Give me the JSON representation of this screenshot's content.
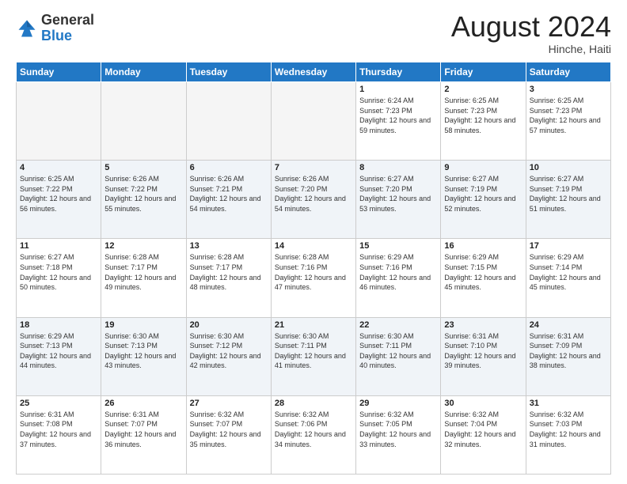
{
  "logo": {
    "general": "General",
    "blue": "Blue"
  },
  "header": {
    "month": "August 2024",
    "location": "Hinche, Haiti"
  },
  "weekdays": [
    "Sunday",
    "Monday",
    "Tuesday",
    "Wednesday",
    "Thursday",
    "Friday",
    "Saturday"
  ],
  "weeks": [
    [
      {
        "day": "",
        "empty": true
      },
      {
        "day": "",
        "empty": true
      },
      {
        "day": "",
        "empty": true
      },
      {
        "day": "",
        "empty": true
      },
      {
        "day": "1",
        "sunrise": "6:24 AM",
        "sunset": "7:23 PM",
        "daylight": "12 hours and 59 minutes."
      },
      {
        "day": "2",
        "sunrise": "6:25 AM",
        "sunset": "7:23 PM",
        "daylight": "12 hours and 58 minutes."
      },
      {
        "day": "3",
        "sunrise": "6:25 AM",
        "sunset": "7:23 PM",
        "daylight": "12 hours and 57 minutes."
      }
    ],
    [
      {
        "day": "4",
        "sunrise": "6:25 AM",
        "sunset": "7:22 PM",
        "daylight": "12 hours and 56 minutes."
      },
      {
        "day": "5",
        "sunrise": "6:26 AM",
        "sunset": "7:22 PM",
        "daylight": "12 hours and 55 minutes."
      },
      {
        "day": "6",
        "sunrise": "6:26 AM",
        "sunset": "7:21 PM",
        "daylight": "12 hours and 54 minutes."
      },
      {
        "day": "7",
        "sunrise": "6:26 AM",
        "sunset": "7:20 PM",
        "daylight": "12 hours and 54 minutes."
      },
      {
        "day": "8",
        "sunrise": "6:27 AM",
        "sunset": "7:20 PM",
        "daylight": "12 hours and 53 minutes."
      },
      {
        "day": "9",
        "sunrise": "6:27 AM",
        "sunset": "7:19 PM",
        "daylight": "12 hours and 52 minutes."
      },
      {
        "day": "10",
        "sunrise": "6:27 AM",
        "sunset": "7:19 PM",
        "daylight": "12 hours and 51 minutes."
      }
    ],
    [
      {
        "day": "11",
        "sunrise": "6:27 AM",
        "sunset": "7:18 PM",
        "daylight": "12 hours and 50 minutes."
      },
      {
        "day": "12",
        "sunrise": "6:28 AM",
        "sunset": "7:17 PM",
        "daylight": "12 hours and 49 minutes."
      },
      {
        "day": "13",
        "sunrise": "6:28 AM",
        "sunset": "7:17 PM",
        "daylight": "12 hours and 48 minutes."
      },
      {
        "day": "14",
        "sunrise": "6:28 AM",
        "sunset": "7:16 PM",
        "daylight": "12 hours and 47 minutes."
      },
      {
        "day": "15",
        "sunrise": "6:29 AM",
        "sunset": "7:16 PM",
        "daylight": "12 hours and 46 minutes."
      },
      {
        "day": "16",
        "sunrise": "6:29 AM",
        "sunset": "7:15 PM",
        "daylight": "12 hours and 45 minutes."
      },
      {
        "day": "17",
        "sunrise": "6:29 AM",
        "sunset": "7:14 PM",
        "daylight": "12 hours and 45 minutes."
      }
    ],
    [
      {
        "day": "18",
        "sunrise": "6:29 AM",
        "sunset": "7:13 PM",
        "daylight": "12 hours and 44 minutes."
      },
      {
        "day": "19",
        "sunrise": "6:30 AM",
        "sunset": "7:13 PM",
        "daylight": "12 hours and 43 minutes."
      },
      {
        "day": "20",
        "sunrise": "6:30 AM",
        "sunset": "7:12 PM",
        "daylight": "12 hours and 42 minutes."
      },
      {
        "day": "21",
        "sunrise": "6:30 AM",
        "sunset": "7:11 PM",
        "daylight": "12 hours and 41 minutes."
      },
      {
        "day": "22",
        "sunrise": "6:30 AM",
        "sunset": "7:11 PM",
        "daylight": "12 hours and 40 minutes."
      },
      {
        "day": "23",
        "sunrise": "6:31 AM",
        "sunset": "7:10 PM",
        "daylight": "12 hours and 39 minutes."
      },
      {
        "day": "24",
        "sunrise": "6:31 AM",
        "sunset": "7:09 PM",
        "daylight": "12 hours and 38 minutes."
      }
    ],
    [
      {
        "day": "25",
        "sunrise": "6:31 AM",
        "sunset": "7:08 PM",
        "daylight": "12 hours and 37 minutes."
      },
      {
        "day": "26",
        "sunrise": "6:31 AM",
        "sunset": "7:07 PM",
        "daylight": "12 hours and 36 minutes."
      },
      {
        "day": "27",
        "sunrise": "6:32 AM",
        "sunset": "7:07 PM",
        "daylight": "12 hours and 35 minutes."
      },
      {
        "day": "28",
        "sunrise": "6:32 AM",
        "sunset": "7:06 PM",
        "daylight": "12 hours and 34 minutes."
      },
      {
        "day": "29",
        "sunrise": "6:32 AM",
        "sunset": "7:05 PM",
        "daylight": "12 hours and 33 minutes."
      },
      {
        "day": "30",
        "sunrise": "6:32 AM",
        "sunset": "7:04 PM",
        "daylight": "12 hours and 32 minutes."
      },
      {
        "day": "31",
        "sunrise": "6:32 AM",
        "sunset": "7:03 PM",
        "daylight": "12 hours and 31 minutes."
      }
    ]
  ]
}
